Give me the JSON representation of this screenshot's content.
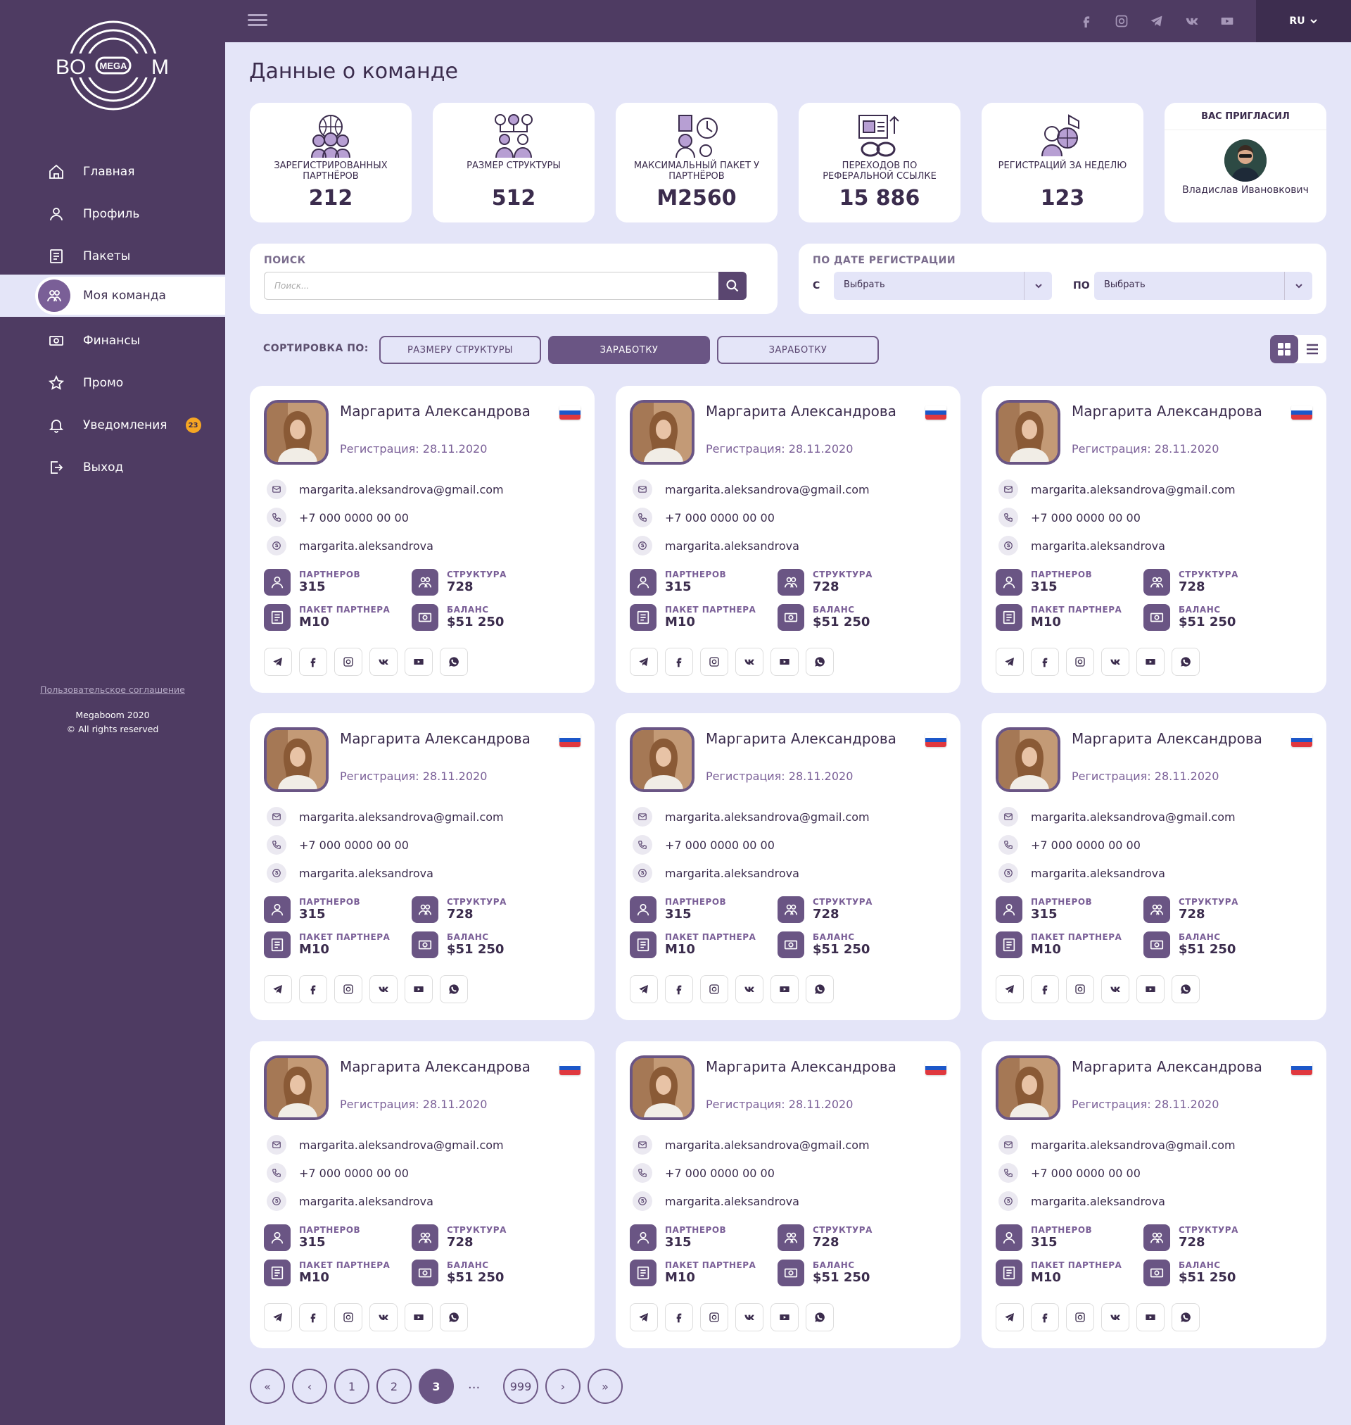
{
  "app": {
    "logo_left": "BO",
    "logo_center": "MEGA",
    "logo_right": "M",
    "language": "RU"
  },
  "sidebar": {
    "items": [
      {
        "label": "Главная",
        "icon": "home-icon"
      },
      {
        "label": "Профиль",
        "icon": "user-icon"
      },
      {
        "label": "Пакеты",
        "icon": "package-icon"
      },
      {
        "label": "Моя команда",
        "icon": "team-icon",
        "active": true
      },
      {
        "label": "Финансы",
        "icon": "money-icon"
      },
      {
        "label": "Промо",
        "icon": "star-icon"
      },
      {
        "label": "Уведомления",
        "icon": "bell-icon",
        "badge": "23"
      },
      {
        "label": "Выход",
        "icon": "logout-icon"
      }
    ],
    "agreement": "Пользовательское соглашение",
    "copyright_line1": "Megaboom 2020",
    "copyright_line2": "© All rights reserved"
  },
  "header": {
    "social_icons": [
      "facebook-icon",
      "instagram-icon",
      "telegram-icon",
      "vk-icon",
      "youtube-icon"
    ]
  },
  "page": {
    "title": "Данные о команде"
  },
  "stats": [
    {
      "label": "ЗАРЕГИСТРИРОВАННЫХ ПАРТНЁРОВ",
      "value": "212"
    },
    {
      "label": "РАЗМЕР СТРУКТУРЫ",
      "value": "512"
    },
    {
      "label": "МАКСИМАЛЬНЫЙ ПАКЕТ У ПАРТНЁРОВ",
      "value": "M2560"
    },
    {
      "label": "ПЕРЕХОДОВ ПО РЕФЕРАЛЬНОЙ ССЫЛКЕ",
      "value": "15 886"
    },
    {
      "label": "РЕГИСТРАЦИЙ ЗА НЕДЕЛЮ",
      "value": "123"
    }
  ],
  "inviter": {
    "title": "ВАС ПРИГЛАСИЛ",
    "name": "Владислав Ивановкович"
  },
  "search": {
    "label": "ПОИСК",
    "placeholder": "Поиск..."
  },
  "date_filter": {
    "label": "ПО ДАТЕ РЕГИСТРАЦИИ",
    "from_label": "С",
    "from_value": "Выбрать",
    "to_label": "ПО",
    "to_value": "Выбрать"
  },
  "sort": {
    "label": "СОРТИРОВКА ПО:",
    "options": [
      "РАЗМЕРУ СТРУКТУРЫ",
      "ЗАРАБОТКУ",
      "ЗАРАБОТКУ"
    ],
    "active_index": 1
  },
  "card": {
    "name": "Маргарита Александрова",
    "registration": "Регистрация: 28.11.2020",
    "email": "margarita.aleksandrova@gmail.com",
    "phone": "+7 000 0000 00 00",
    "skype": "margarita.aleksandrova",
    "partners_label": "ПАРТНЕРОВ",
    "partners_value": "315",
    "structure_label": "СТРУКТУРА",
    "structure_value": "728",
    "package_label": "ПАКЕТ ПАРТНЕРА",
    "package_value": "M10",
    "balance_label": "БАЛАНС",
    "balance_value": "$51 250",
    "flag_colors": [
      "#ffffff",
      "#1c57c9",
      "#e0383e"
    ],
    "socials": [
      "telegram-icon",
      "facebook-icon",
      "instagram-icon",
      "vk-icon",
      "youtube-icon",
      "whatsapp-icon"
    ]
  },
  "cards_count": 9,
  "pagination": {
    "first": "«",
    "prev": "‹",
    "pages": [
      "1",
      "2",
      "3"
    ],
    "current": "3",
    "dots": "...",
    "last_page": "999",
    "next": "›",
    "last": "»"
  },
  "colors": {
    "primary": "#4e3b62",
    "accent": "#6a5584",
    "background": "#e4e5f8",
    "badge": "#f6a623"
  }
}
